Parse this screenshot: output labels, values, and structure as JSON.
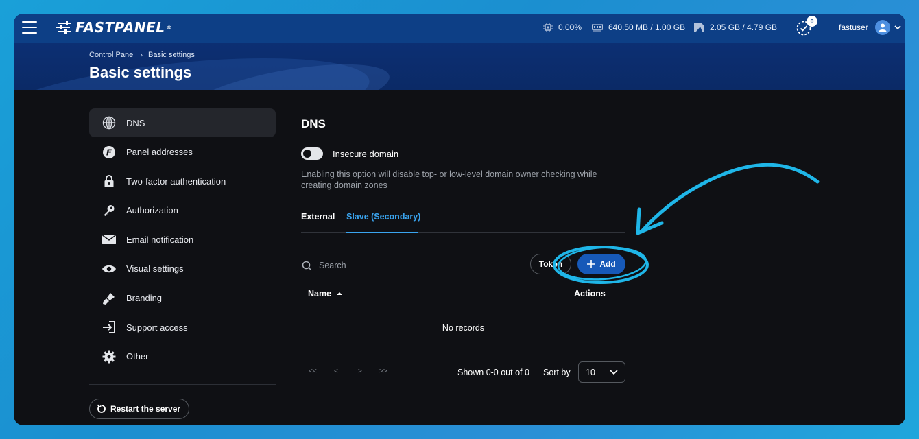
{
  "app": {
    "logo_text": "FASTPANEL",
    "logo_mark": "®"
  },
  "topbar": {
    "cpu": "0.00%",
    "ram": "640.50 MB / 1.00 GB",
    "disk": "2.05 GB / 4.79 GB",
    "tasks_badge": "0",
    "user": "fastuser"
  },
  "breadcrumb": {
    "root": "Control Panel",
    "current": "Basic settings"
  },
  "page_title": "Basic settings",
  "sidebar": {
    "items": [
      {
        "label": "DNS",
        "icon": "globe-icon"
      },
      {
        "label": "Panel addresses",
        "icon": "panel-f-icon"
      },
      {
        "label": "Two-factor authentication",
        "icon": "lock-icon"
      },
      {
        "label": "Authorization",
        "icon": "key-icon"
      },
      {
        "label": "Email notification",
        "icon": "envelope-icon"
      },
      {
        "label": "Visual settings",
        "icon": "eye-icon"
      },
      {
        "label": "Branding",
        "icon": "brush-icon"
      },
      {
        "label": "Support access",
        "icon": "enter-icon"
      },
      {
        "label": "Other",
        "icon": "gear-icon"
      }
    ],
    "restart_label": "Restart the server"
  },
  "main": {
    "title": "DNS",
    "toggle_label": "Insecure domain",
    "hint": "Enabling this option will disable top- or low-level domain owner checking while creating domain zones",
    "tabs": [
      "External",
      "Slave (Secondary)"
    ],
    "search_placeholder": "Search",
    "token_label": "Token",
    "add_label": "Add",
    "columns": [
      "Name",
      "Actions"
    ],
    "empty": "No records",
    "pager": [
      "<<",
      "<",
      ">",
      ">>"
    ],
    "shown": "Shown 0-0 out of 0",
    "sort_label": "Sort by",
    "per_page": "10"
  },
  "colors": {
    "accent": "#3aa4ef",
    "primary_button": "#1759b8",
    "topbar": "#0d3f86",
    "annotation": "#1fb6e8"
  }
}
